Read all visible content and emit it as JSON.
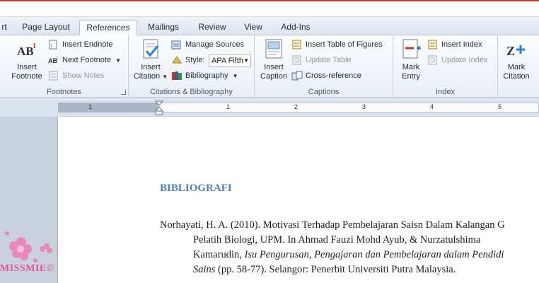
{
  "tabs": [
    "rt",
    "Page Layout",
    "References",
    "Mailings",
    "Review",
    "View",
    "Add-Ins"
  ],
  "active_tab": "References",
  "ribbon": {
    "footnotes": {
      "label": "Footnotes",
      "insert_footnote": "Insert\nFootnote",
      "insert_footnote_l1": "Insert",
      "insert_footnote_l2": "Footnote",
      "insert_endnote": "Insert Endnote",
      "next_footnote": "Next Footnote",
      "show_notes": "Show Notes"
    },
    "citations": {
      "label": "Citations & Bibliography",
      "insert_citation_l1": "Insert",
      "insert_citation_l2": "Citation",
      "manage_sources": "Manage Sources",
      "style_label": "Style:",
      "style_value": "APA Fifth",
      "bibliography": "Bibliography"
    },
    "captions": {
      "label": "Captions",
      "insert_caption_l1": "Insert",
      "insert_caption_l2": "Caption",
      "insert_table_of_figures": "Insert Table of Figures",
      "update_table": "Update Table",
      "cross_reference": "Cross-reference"
    },
    "index": {
      "label": "Index",
      "mark_entry_l1": "Mark",
      "mark_entry_l2": "Entry",
      "insert_index": "Insert Index",
      "update_index": "Update Index"
    },
    "toa": {
      "mark_citation_l1": "Mark",
      "mark_citation_l2": "Citation"
    }
  },
  "ruler_numbers": [
    "1",
    "1",
    "2",
    "3",
    "4",
    "5"
  ],
  "document": {
    "heading": "BIBLIOGRAFI",
    "entry_line1": "Norhayati, H. A. (2010). Motivasi Terhadap Pembelajaran Saisn Dalam Kalangan G",
    "entry_line2": "Pelatih Biologi, UPM. In Ahmad Fauzi Mohd Ayub, & Nurzatulshima",
    "entry_line3_plain": "Kamarudin, ",
    "entry_line3_italic": "Isu Pengurusan, Pengajaran dan Pembelajaran dalam Pendidi",
    "entry_line4_italic": "Sains",
    "entry_line4_plain": " (pp. 58-77). Selangor: Penerbit Universiti Putra Malaysia."
  },
  "watermark": "MISSMIE©",
  "colors": {
    "heading": "#4f81bd",
    "watermark": "#e3579b",
    "accent_red": "#c0392b"
  }
}
